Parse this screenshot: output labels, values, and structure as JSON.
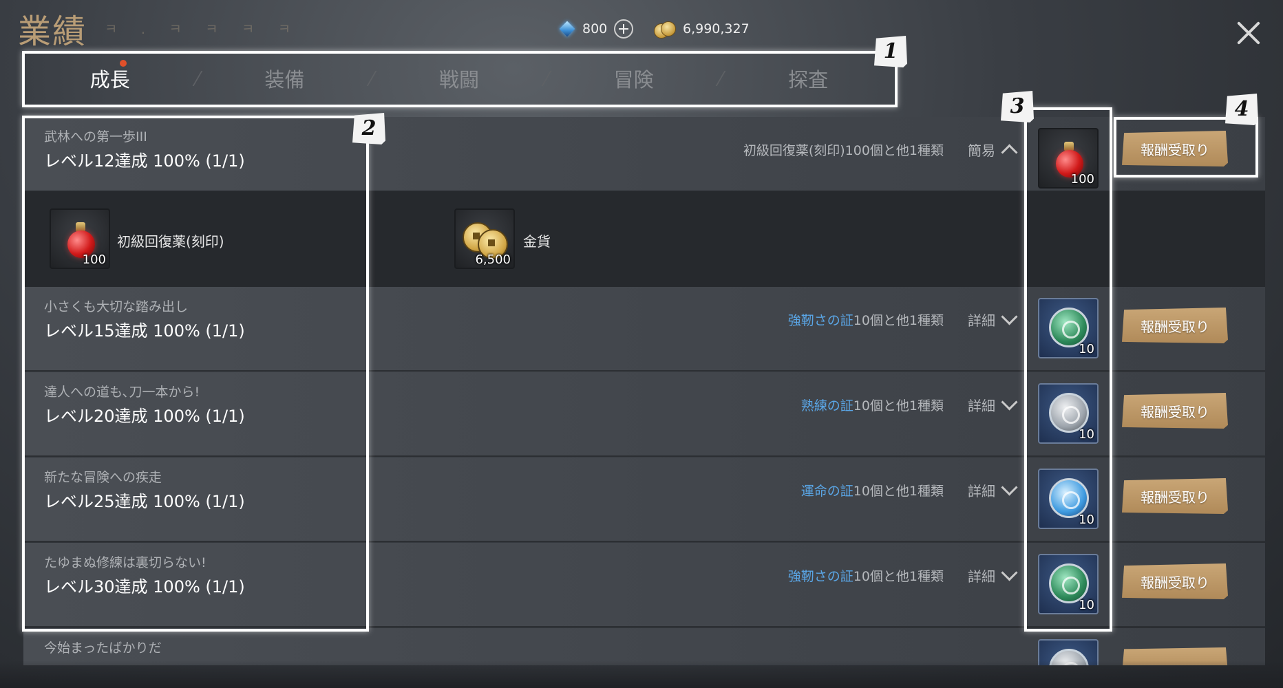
{
  "header": {
    "title": "業績",
    "title_deco": "ㅋ . ㅋ ㅋ ㅋ ㅋ",
    "gems": "800",
    "gold": "6,990,327"
  },
  "tabs": [
    {
      "label": "成長",
      "active": true,
      "badge": true
    },
    {
      "label": "装備",
      "active": false
    },
    {
      "label": "戦闘",
      "active": false
    },
    {
      "label": "冒険",
      "active": false
    },
    {
      "label": "探査",
      "active": false
    }
  ],
  "annotations": [
    "1",
    "2",
    "3",
    "4"
  ],
  "achievements": [
    {
      "subtitle": "武林への第一歩III",
      "title": "レベル12達成 100% (1/1)",
      "reward_highlight": "",
      "reward_text": "初級回復薬(刻印)100個と他1種類",
      "toggle": "簡易",
      "expanded": true,
      "item_qty": "100",
      "claim": "報酬受取り",
      "details": [
        {
          "name": "初級回復薬(刻印)",
          "qty": "100"
        },
        {
          "name": "金貨",
          "qty": "6,500"
        }
      ]
    },
    {
      "subtitle": "小さくも大切な踏み出し",
      "title": "レベル15達成 100% (1/1)",
      "reward_highlight": "強靭さの証",
      "reward_text": "10個と他1種類",
      "toggle": "詳細",
      "expanded": false,
      "item_qty": "10",
      "claim": "報酬受取り"
    },
    {
      "subtitle": "達人への道も､刀一本から!",
      "title": "レベル20達成 100% (1/1)",
      "reward_highlight": "熟練の証",
      "reward_text": "10個と他1種類",
      "toggle": "詳細",
      "expanded": false,
      "item_qty": "10",
      "claim": "報酬受取り"
    },
    {
      "subtitle": "新たな冒険への疾走",
      "title": "レベル25達成 100% (1/1)",
      "reward_highlight": "運命の証",
      "reward_text": "10個と他1種類",
      "toggle": "詳細",
      "expanded": false,
      "item_qty": "10",
      "claim": "報酬受取り"
    },
    {
      "subtitle": "たゆまぬ修練は裏切らない!",
      "title": "レベル30達成 100% (1/1)",
      "reward_highlight": "強靭さの証",
      "reward_text": "10個と他1種類",
      "toggle": "詳細",
      "expanded": false,
      "item_qty": "10",
      "claim": "報酬受取り"
    },
    {
      "subtitle": "今始まったばかりだ"
    }
  ]
}
